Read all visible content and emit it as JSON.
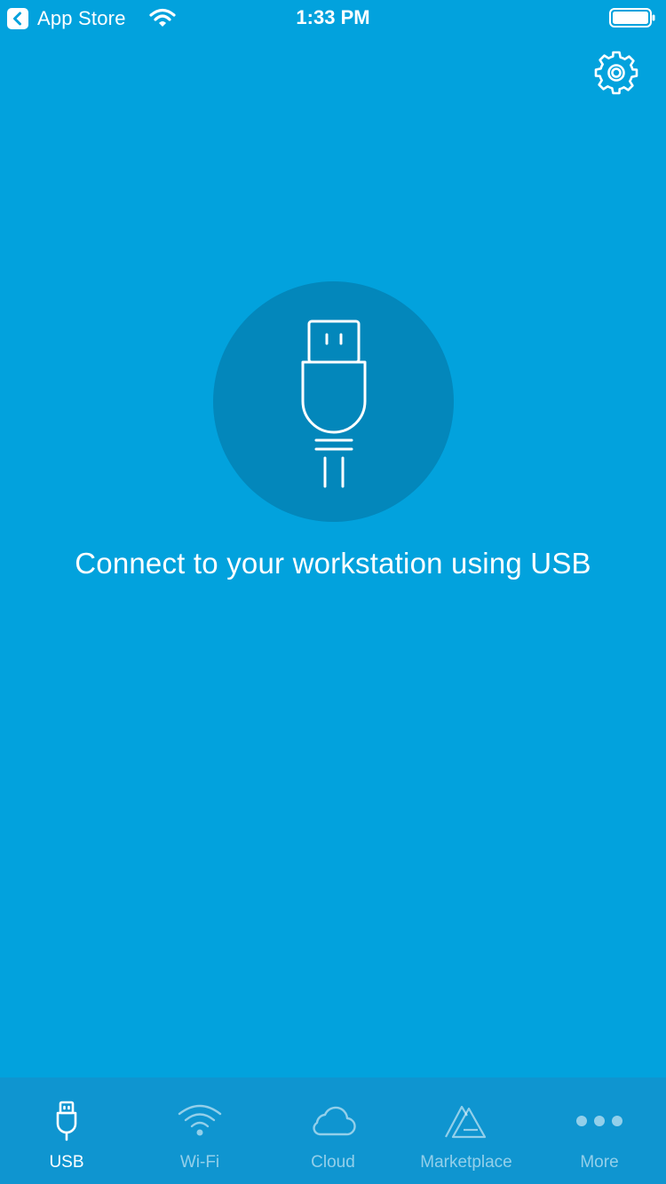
{
  "status_bar": {
    "back_app": "App Store",
    "time": "1:33 PM"
  },
  "main": {
    "message": "Connect to your workstation using USB",
    "hero_icon": "usb-plug-icon"
  },
  "settings": {
    "icon": "gear-icon"
  },
  "tabs": [
    {
      "label": "USB",
      "icon": "usb-icon",
      "active": true
    },
    {
      "label": "Wi-Fi",
      "icon": "wifi-icon",
      "active": false
    },
    {
      "label": "Cloud",
      "icon": "cloud-icon",
      "active": false
    },
    {
      "label": "Marketplace",
      "icon": "marketplace-icon",
      "active": false
    },
    {
      "label": "More",
      "icon": "more-icon",
      "active": false
    }
  ],
  "colors": {
    "background": "#02a2dd",
    "hero_circle": "#0387bb",
    "tab_bar": "#0f95d0",
    "active": "#ffffff",
    "inactive": "rgba(255,255,255,0.55)"
  }
}
